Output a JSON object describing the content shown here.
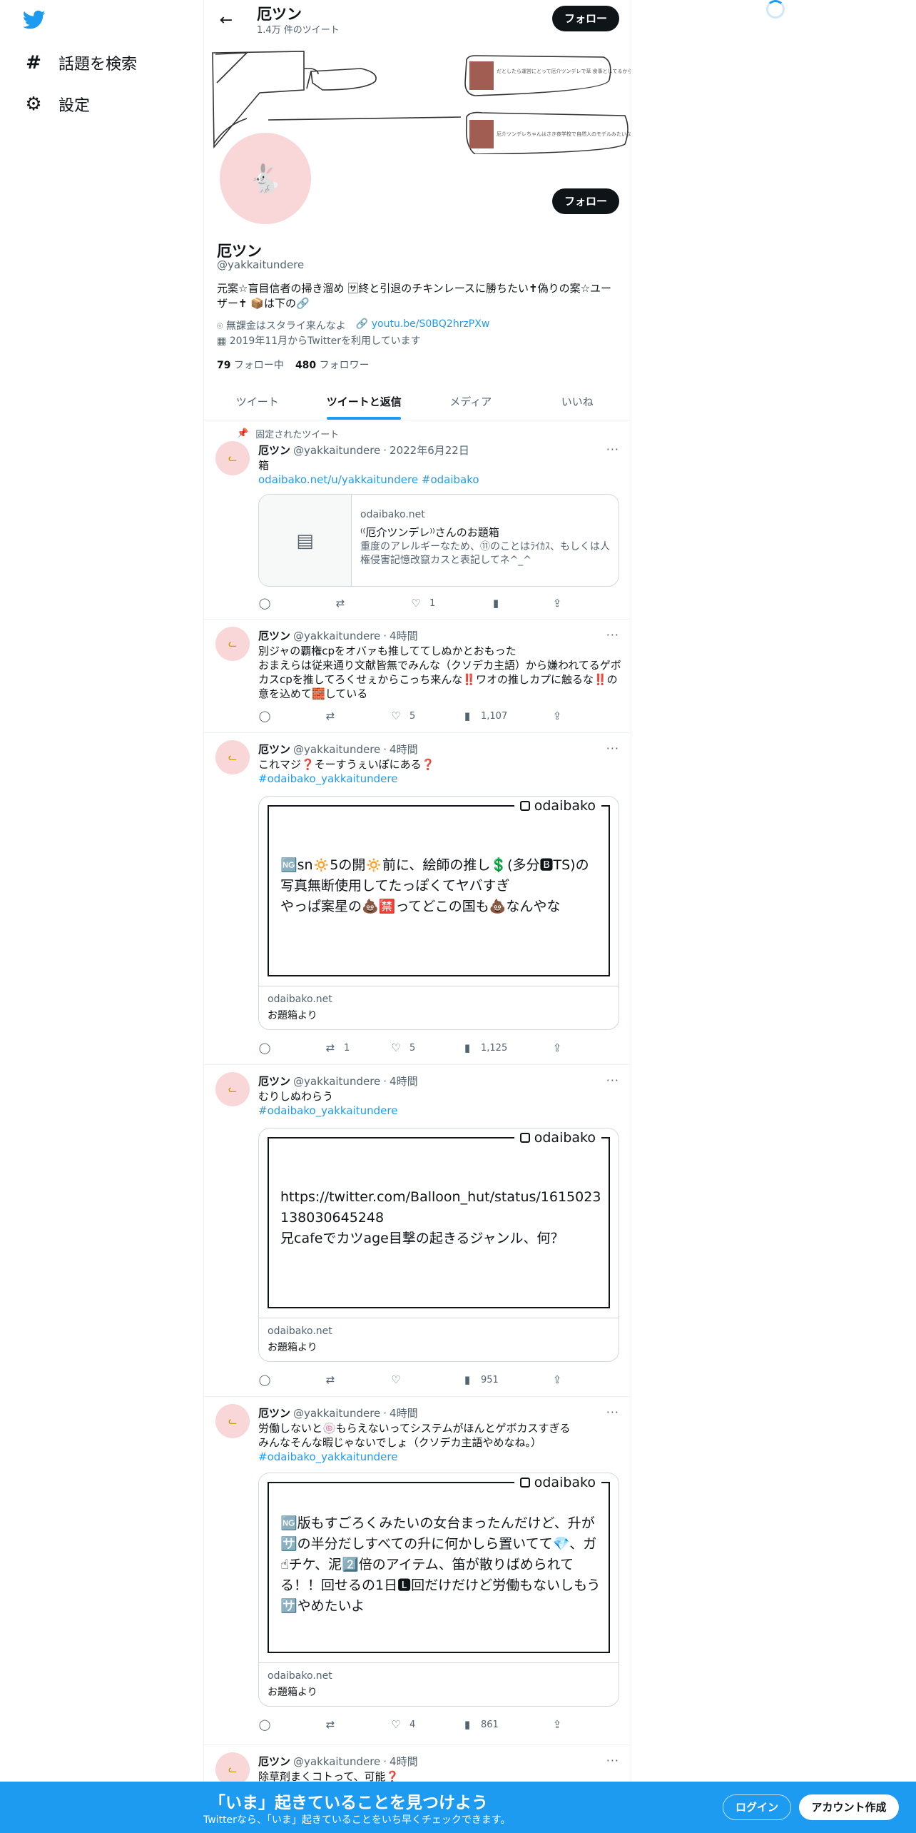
{
  "sidebar": {
    "items": [
      {
        "icon": "hashtag-icon",
        "label": "話題を検索"
      },
      {
        "icon": "gear-icon",
        "label": "設定"
      }
    ]
  },
  "header": {
    "name": "厄ツン",
    "tweet_count": "1.4万 件のツイート",
    "follow_label": "フォロー"
  },
  "banner": {
    "note1": "だとしたら運営にとって厄介ツンデレで草 食事としてるから運営に嫌はないか一覧",
    "note2": "厄介ツンデレちゃんはさき夜学校で自然入のモデルみたいな奥があるような気がした"
  },
  "profile": {
    "name": "厄ツン",
    "handle": "@yakkaitundere",
    "bio": "元案☆盲目信者の掃き溜め 🈂終と引退のチキンレースに勝ちたい✝偽りの案☆ユーザー✝ 📦は下の🔗",
    "location": "無課金はスタライ来んなよ",
    "link": "youtu.be/S0BQ2hrzPXw",
    "joined": "2019年11月からTwitterを利用しています",
    "following_count": "79",
    "following_label": "フォロー中",
    "followers_count": "480",
    "followers_label": "フォロワー",
    "follow_label": "フォロー"
  },
  "tabs": [
    {
      "label": "ツイート",
      "active": false
    },
    {
      "label": "ツイートと返信",
      "active": true
    },
    {
      "label": "メディア",
      "active": false
    },
    {
      "label": "いいね",
      "active": false
    }
  ],
  "tweets": [
    {
      "pinned_label": "固定されたツイート",
      "name": "厄ツン",
      "handle": "@yakkaitundere",
      "time": "2022年6月22日",
      "text1": "箱",
      "link_text": "odaibako.net/u/yakkaitundere",
      "tag": "#odaibako",
      "card_domain": "odaibako.net",
      "card_title": "⁽⁽厄介ツンデレ⁾⁾さんのお題箱",
      "card_desc": "重度のアレルギーなため、⑪のことはﾗｲｶｽ、もしくは人権侵害記憶改竄カスと表記してネ^_^",
      "likes": "1",
      "views": ""
    },
    {
      "name": "厄ツン",
      "handle": "@yakkaitundere",
      "time": "4時間",
      "text": "別ジャの覇権cpをオバァも推しててしぬかとおもった\nおまえらは従来通り文献皆無でみんな（クソデカ主語）から嫌われてるゲボカスcpを推してろくせぇからこっち来んな‼️ワオの推しカプに触るな‼️の意を込めて🧱している",
      "likes": "5",
      "views": "1,107"
    },
    {
      "name": "厄ツン",
      "handle": "@yakkaitundere",
      "time": "4時間",
      "text": "これマジ❓そーすうぇいぽにある❓",
      "tag": "#odaibako_yakkaitundere",
      "brand": "odaibako",
      "image_text": "🆖sn🔅5の開🔅前に、絵師の推し💲(多分🅱TS)の写真無断使用してたっぽくてヤバすぎ\nやっぱ案星の💩🈲ってどこの国も💩なんやな",
      "card_domain": "odaibako.net",
      "card_title": "お題箱より",
      "retweets": "1",
      "likes": "5",
      "views": "1,125"
    },
    {
      "name": "厄ツン",
      "handle": "@yakkaitundere",
      "time": "4時間",
      "text": "むりしぬわらう",
      "tag": "#odaibako_yakkaitundere",
      "brand": "odaibako",
      "image_text": "https://twitter.com/Balloon_hut/status/1615023138030645248\n兄cafeでカツage目撃の起きるジャンル、何？",
      "card_domain": "odaibako.net",
      "card_title": "お題箱より",
      "views": "951"
    },
    {
      "name": "厄ツン",
      "handle": "@yakkaitundere",
      "time": "4時間",
      "text": "労働しないと🍥もらえないってシステムがほんとゲボカスすぎる\nみんなそんな暇じゃないでしょ（クソデカ主語やめなね。）",
      "tag": "#odaibako_yakkaitundere",
      "brand": "odaibako",
      "image_text": "🆖版もすごろくみたいの女台まったんだけど、升が🈂️の半分だしすべての升に何かしら置いてて💎、ガ☝チケ、泥2️⃣倍のアイテム、笛が散りばめられてる！！回せるの1日🅻回だけだけど労働もないしもう🈂️やめたいよ",
      "card_domain": "odaibako.net",
      "card_title": "お題箱より",
      "likes": "4",
      "views": "861"
    },
    {
      "name": "厄ツン",
      "handle": "@yakkaitundere",
      "time": "4時間",
      "text": "除草剤まくコトって、可能❓"
    }
  ],
  "bottom_bar": {
    "title": "「いま」起きていることを見つけよう",
    "subtitle": "Twitterなら、「いま」起きていることをいち早くチェックできます。",
    "login": "ログイン",
    "signup": "アカウント作成"
  },
  "colors": {
    "accent": "#1d9bf0",
    "text": "#0f1419",
    "muted": "#536471",
    "avatar_bg": "#f9d6d8"
  }
}
